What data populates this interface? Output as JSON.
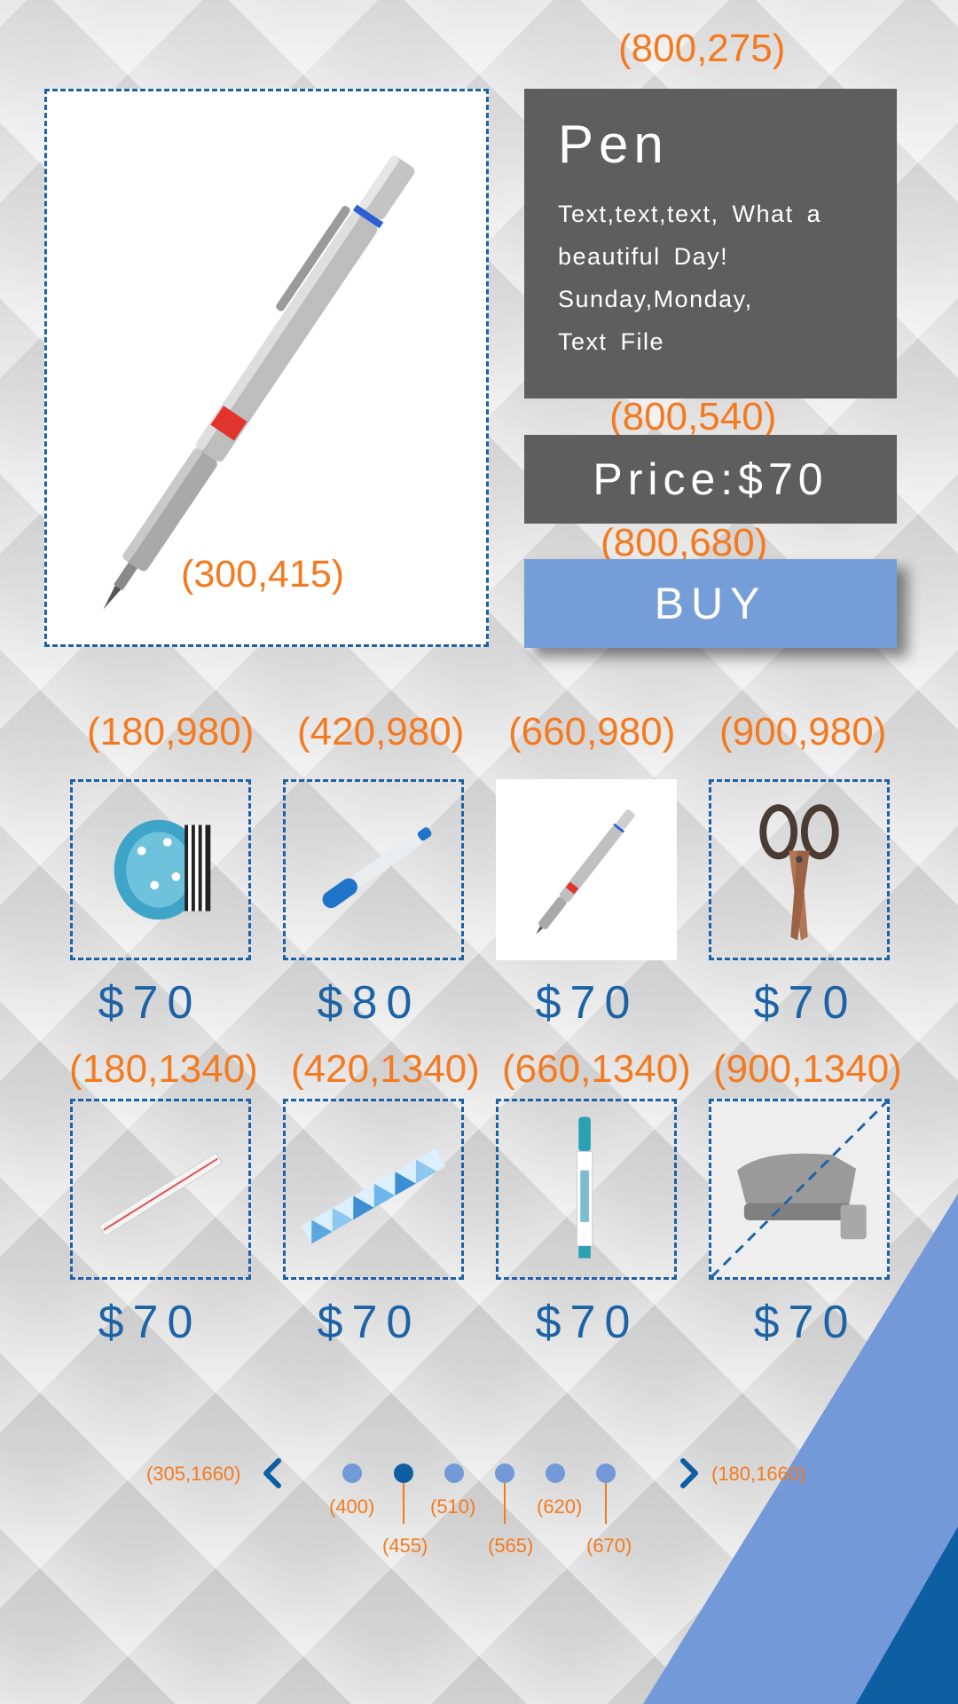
{
  "main": {
    "title": "Pen",
    "description_lines": [
      "Text,text,text, What a",
      "beautiful Day!",
      "Sunday,Monday,",
      "Text File"
    ],
    "price": "Price:$70",
    "buy_label": "BUY",
    "image_coord": "(300,415)",
    "info_coord": "(800,275)",
    "price_coord": "(800,540)",
    "buy_coord": "(800,680)"
  },
  "thumbnails": [
    {
      "coord": "(180,980)",
      "price": "$70",
      "icon": "washi-tape-icon"
    },
    {
      "coord": "(420,980)",
      "price": "$80",
      "icon": "marker-icon"
    },
    {
      "coord": "(660,980)",
      "price": "$70",
      "icon": "mechanical-pencil-icon"
    },
    {
      "coord": "(900,980)",
      "price": "$70",
      "icon": "scissors-icon"
    },
    {
      "coord": "(180,1340)",
      "price": "$70",
      "icon": "ruler-icon"
    },
    {
      "coord": "(420,1340)",
      "price": "$70",
      "icon": "tape-strip-icon"
    },
    {
      "coord": "(660,1340)",
      "price": "$70",
      "icon": "highlighter-pen-icon"
    },
    {
      "coord": "(900,1340)",
      "price": "$70",
      "icon": "stapler-icon"
    }
  ],
  "pagination": {
    "prev_coord": "(305,1660)",
    "next_coord": "(180,1660)",
    "dot_labels": [
      "(400)",
      "(455)",
      "(510)",
      "(565)",
      "(620)",
      "(670)"
    ],
    "active_index": 1
  },
  "colors": {
    "accent_orange": "#f47a20",
    "primary_blue": "#1c63a6",
    "light_blue": "#7399d8",
    "dark_blue": "#0e5fa1",
    "panel_gray": "#5e5e5e"
  }
}
